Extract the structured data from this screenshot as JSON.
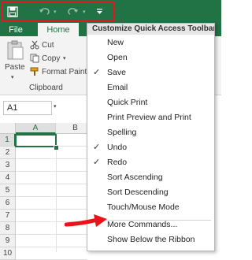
{
  "ribbon": {
    "tabs": [
      "File",
      "Home"
    ],
    "clipboard": {
      "paste_label": "Paste",
      "cut_label": "Cut",
      "copy_label": "Copy",
      "format_painter_label": "Format Painte",
      "group_label": "Clipboard"
    }
  },
  "name_box": {
    "value": "A1"
  },
  "grid": {
    "columns": [
      "A",
      "B"
    ],
    "rows": [
      "1",
      "2",
      "3",
      "4",
      "5",
      "6",
      "7",
      "8",
      "9",
      "10"
    ]
  },
  "menu": {
    "title": "Customize Quick Access Toolbar",
    "items": [
      {
        "label": "New",
        "checked": false
      },
      {
        "label": "Open",
        "checked": false
      },
      {
        "label": "Save",
        "checked": true
      },
      {
        "label": "Email",
        "checked": false
      },
      {
        "label": "Quick Print",
        "checked": false
      },
      {
        "label": "Print Preview and Print",
        "checked": false
      },
      {
        "label": "Spelling",
        "checked": false
      },
      {
        "label": "Undo",
        "checked": true
      },
      {
        "label": "Redo",
        "checked": true
      },
      {
        "label": "Sort Ascending",
        "checked": false
      },
      {
        "label": "Sort Descending",
        "checked": false
      },
      {
        "label": "Touch/Mouse Mode",
        "checked": false
      },
      {
        "label": "More Commands...",
        "checked": false
      },
      {
        "label": "Show Below the Ribbon",
        "checked": false
      }
    ],
    "check_glyph": "✓"
  },
  "colors": {
    "brand_green": "#217346",
    "highlight_red": "#e8141a"
  },
  "icons": [
    "save-icon",
    "undo-icon",
    "redo-icon",
    "customize-dropdown-icon",
    "cut-icon",
    "copy-icon",
    "format-painter-icon",
    "paste-icon",
    "red-arrow-annotation"
  ]
}
